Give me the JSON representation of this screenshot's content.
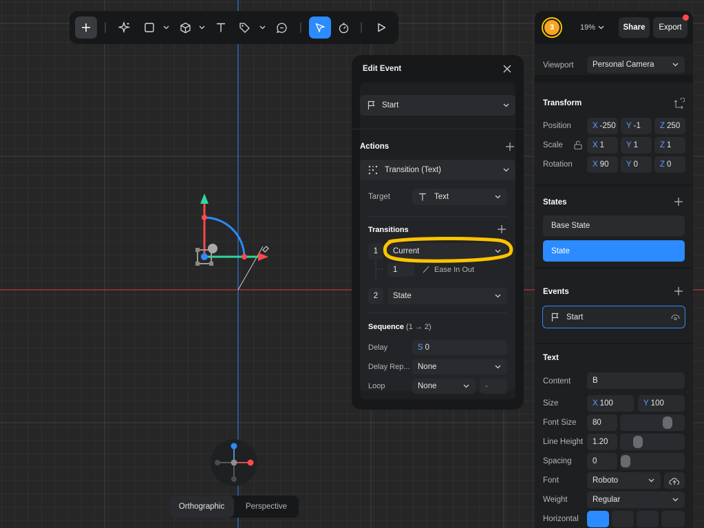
{
  "toolbar": {
    "zoom": "19%",
    "share_label": "Share",
    "export_label": "Export",
    "avatar_initial": "3"
  },
  "viewport": {
    "label": "Viewport",
    "value": "Personal Camera"
  },
  "transform": {
    "title": "Transform",
    "position_label": "Position",
    "scale_label": "Scale",
    "rotation_label": "Rotation",
    "position": {
      "x": "-250",
      "y": "-1",
      "z": "250"
    },
    "scale": {
      "x": "1",
      "y": "1",
      "z": "1"
    },
    "rotation": {
      "x": "90",
      "y": "0",
      "z": "0"
    }
  },
  "axes": {
    "x": "X",
    "y": "Y",
    "z": "Z",
    "s": "S"
  },
  "states": {
    "title": "States",
    "items": [
      "Base State",
      "State"
    ]
  },
  "events": {
    "title": "Events",
    "item": "Start"
  },
  "text_section": {
    "title": "Text",
    "content_label": "Content",
    "content": "B",
    "size_label": "Size",
    "size_x": "100",
    "size_y": "100",
    "font_size_label": "Font Size",
    "font_size": "80",
    "line_height_label": "Line Height",
    "line_height": "1.20",
    "spacing_label": "Spacing",
    "spacing": "0",
    "font_label": "Font",
    "font": "Roboto",
    "weight_label": "Weight",
    "weight": "Regular",
    "h_align_label": "Horizontal"
  },
  "edit_event": {
    "title": "Edit Event",
    "trigger": "Start",
    "actions_title": "Actions",
    "action": "Transition (Text)",
    "target_label": "Target",
    "target": "Text",
    "transitions_title": "Transitions",
    "transition1_index": "1",
    "transition1_value": "Current",
    "duration": "1",
    "easing": "Ease In Out",
    "transition2_index": "2",
    "transition2_value": "State",
    "sequence_title": "Sequence",
    "sequence_range": "(1 → 2)",
    "delay_label": "Delay",
    "delay": "0",
    "delay_repeat_label": "Delay Rep...",
    "delay_repeat": "None",
    "loop_label": "Loop",
    "loop": "None",
    "loop_count": "-"
  },
  "view_mode": {
    "orthographic": "Orthographic",
    "perspective": "Perspective"
  },
  "colors": {
    "accent": "#2b8bff",
    "highlight": "#ffc400",
    "axis_red": "#ff4a4a",
    "axis_green": "#2fd6a0",
    "axis_blue": "#2b8bff"
  }
}
